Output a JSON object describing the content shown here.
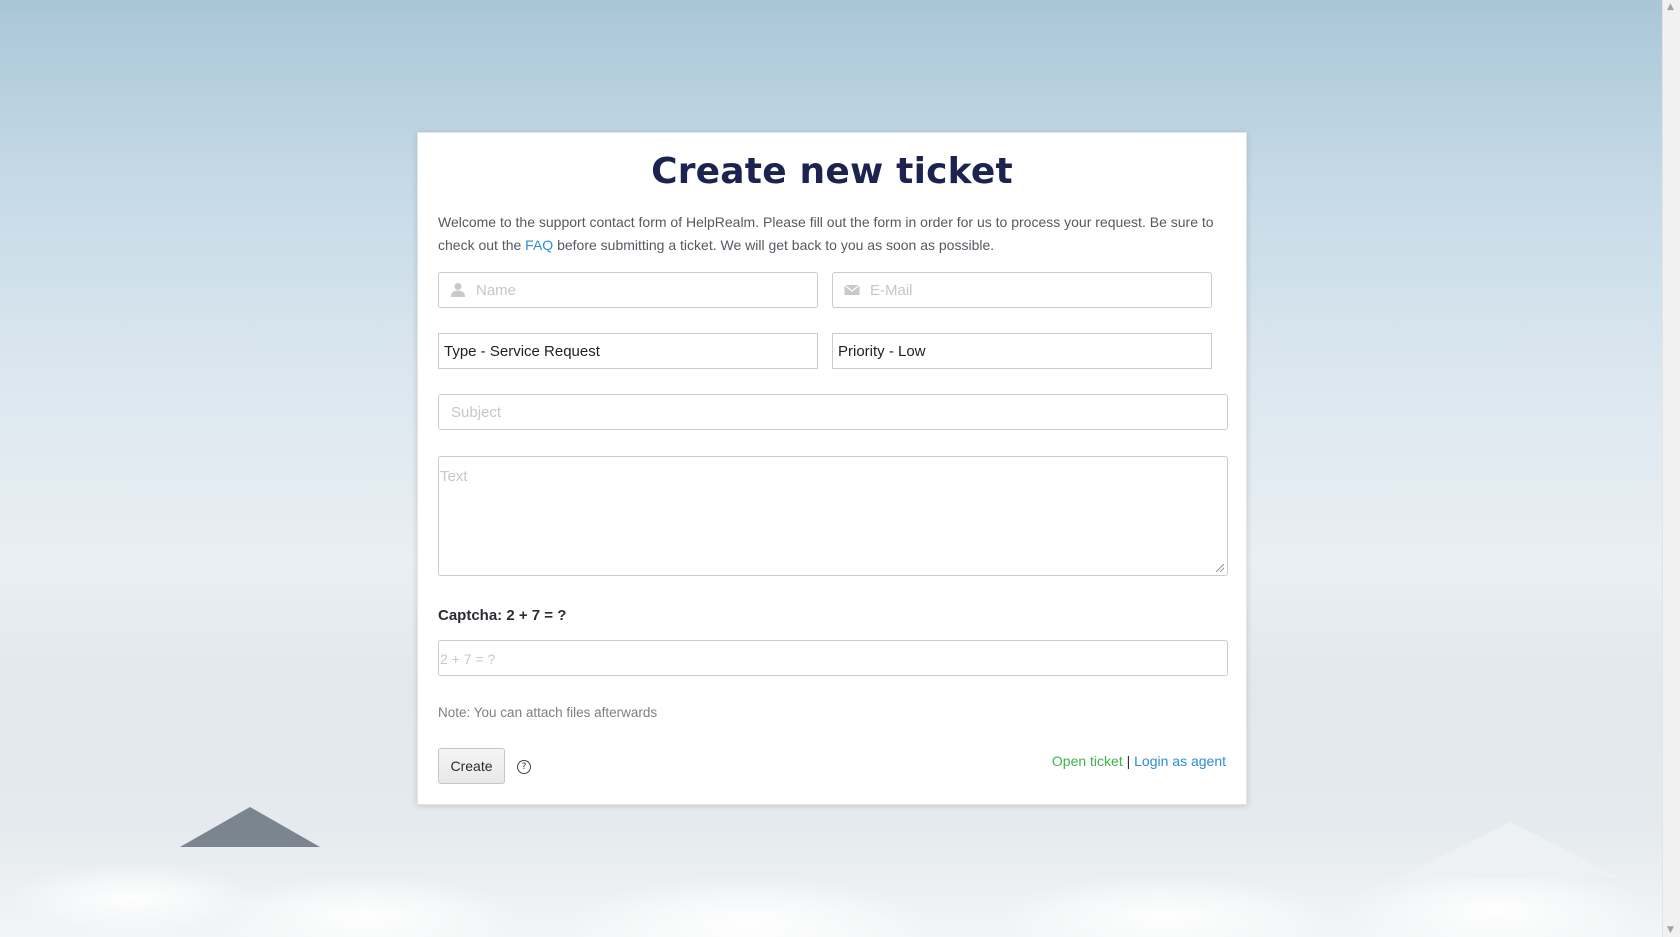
{
  "page": {
    "title": "Create new ticket",
    "intro_part1": "Welcome to the support contact form of HelpRealm. Please fill out the form in order for us to process your request. Be sure to check out the ",
    "intro_link": "FAQ",
    "intro_part2": " before submitting a ticket. We will get back to you as soon as possible."
  },
  "form": {
    "name_placeholder": "Name",
    "email_placeholder": "E-Mail",
    "type_value": "Type - Service Request",
    "priority_value": "Priority - Low",
    "subject_placeholder": "Subject",
    "text_placeholder": "Text",
    "captcha_label": "Captcha: 2 + 7 = ?",
    "captcha_placeholder": "2 + 7 = ?",
    "note": "Note: You can attach files afterwards",
    "create_label": "Create",
    "help_icon_glyph": "?"
  },
  "footer_links": {
    "open_ticket": "Open ticket",
    "separator": "|",
    "login_agent": "Login as agent"
  },
  "icons": {
    "name": "user-icon",
    "email": "envelope-icon",
    "help": "question-circle-icon"
  },
  "colors": {
    "title": "#1d2350",
    "link_blue": "#2b8dd6",
    "link_green": "#3cb54a"
  }
}
